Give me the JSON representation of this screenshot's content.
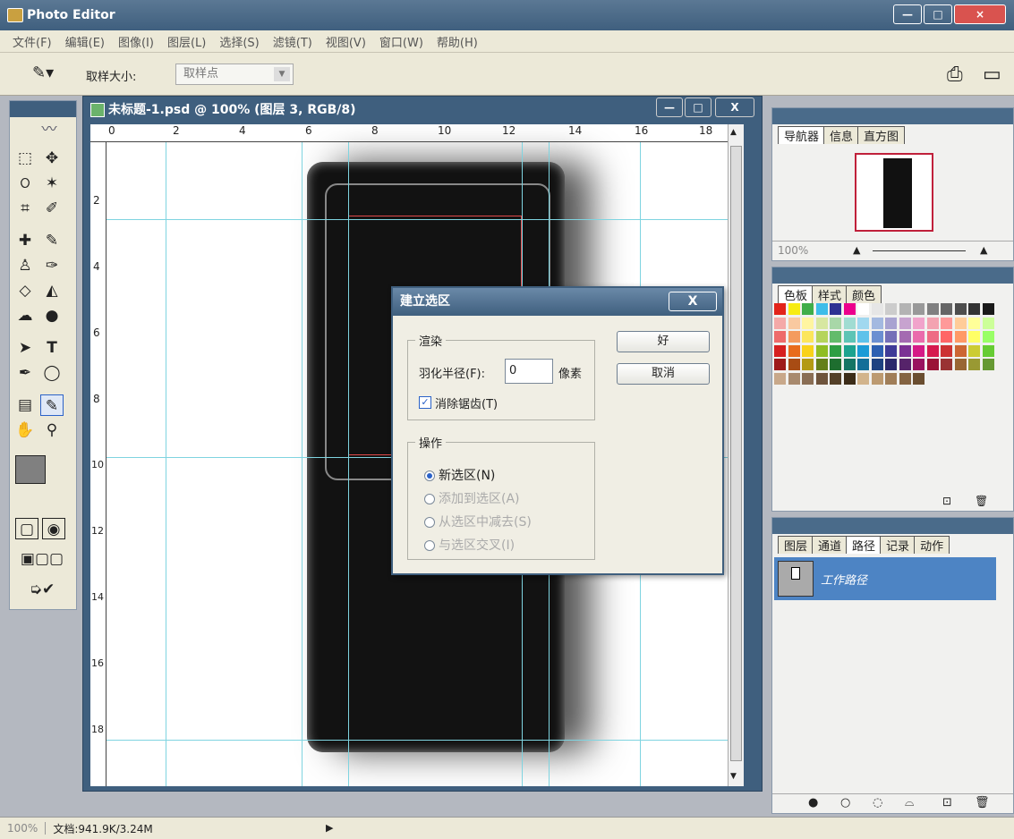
{
  "app": {
    "title": "Photo Editor",
    "window_buttons": [
      "—",
      "□",
      "×"
    ]
  },
  "menu": [
    "文件(F)",
    "编辑(E)",
    "图像(I)",
    "图层(L)",
    "选择(S)",
    "滤镜(T)",
    "视图(V)",
    "窗口(W)",
    "帮助(H)"
  ],
  "options": {
    "sample_size_label": "取样大小:",
    "sample_size_value": "取样点"
  },
  "document": {
    "title": "未标题-1.psd @ 100% (图层 3, RGB/8)",
    "ruler_top": [
      "0",
      "2",
      "4",
      "6",
      "8",
      "10",
      "12",
      "14",
      "16",
      "18"
    ],
    "ruler_left": [
      "2",
      "4",
      "6",
      "8",
      "10",
      "12",
      "14",
      "16",
      "18"
    ]
  },
  "navigator": {
    "tabs": [
      "导航器",
      "信息",
      "直方图"
    ],
    "zoom": "100%"
  },
  "swatches": {
    "tabs": [
      "色板",
      "样式",
      "颜色"
    ]
  },
  "layers": {
    "tabs": [
      "图层",
      "通道",
      "路径",
      "记录",
      "动作"
    ],
    "path_item": "工作路径"
  },
  "dialog": {
    "title": "建立选区",
    "close": "X",
    "render_group": "渲染",
    "feather_label": "羽化半径(F):",
    "feather_value": "0",
    "feather_unit": "像素",
    "antialias_label": "消除锯齿(T)",
    "antialias_checked": true,
    "ok": "好",
    "cancel": "取消",
    "op_group": "操作",
    "ops": [
      {
        "label": "新选区(N)",
        "selected": true,
        "enabled": true
      },
      {
        "label": "添加到选区(A)",
        "selected": false,
        "enabled": false
      },
      {
        "label": "从选区中减去(S)",
        "selected": false,
        "enabled": false
      },
      {
        "label": "与选区交叉(I)",
        "selected": false,
        "enabled": false
      }
    ]
  },
  "status": {
    "zoom": "100%",
    "doc": "文档:941.9K/3.24M"
  }
}
